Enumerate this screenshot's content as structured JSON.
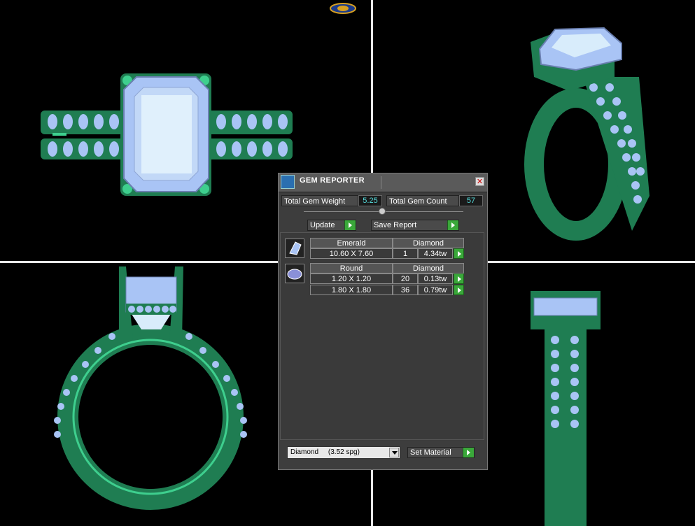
{
  "panel": {
    "title": "GEM REPORTER",
    "close_icon": "close-icon",
    "total_gem_weight_label": "Total Gem Weight",
    "total_gem_weight_value": "5.25",
    "total_gem_count_label": "Total Gem Count",
    "total_gem_count_value": "57",
    "update_label": "Update",
    "save_report_label": "Save Report",
    "groups": [
      {
        "shape": "Emerald",
        "material": "Diamond",
        "icon": "emerald-cut-gem-icon",
        "rows": [
          {
            "size": "10.60 X 7.60",
            "count": "1",
            "weight": "4.34tw"
          }
        ]
      },
      {
        "shape": "Round",
        "material": "Diamond",
        "icon": "round-gem-icon",
        "rows": [
          {
            "size": "1.20 X 1.20",
            "count": "20",
            "weight": "0.13tw"
          },
          {
            "size": "1.80 X 1.80",
            "count": "36",
            "weight": "0.79tw"
          }
        ]
      }
    ],
    "material_select_value": "Diamond     (3.52 spg)",
    "set_material_label": "Set Material"
  },
  "colors": {
    "metal": "#1f7d52",
    "metal_highlight": "#3ecf8e",
    "gem": "#a9c4f5",
    "gem_light": "#d8ecfb",
    "accent_green": "#3aa83a",
    "value_cyan": "#55dddd"
  }
}
